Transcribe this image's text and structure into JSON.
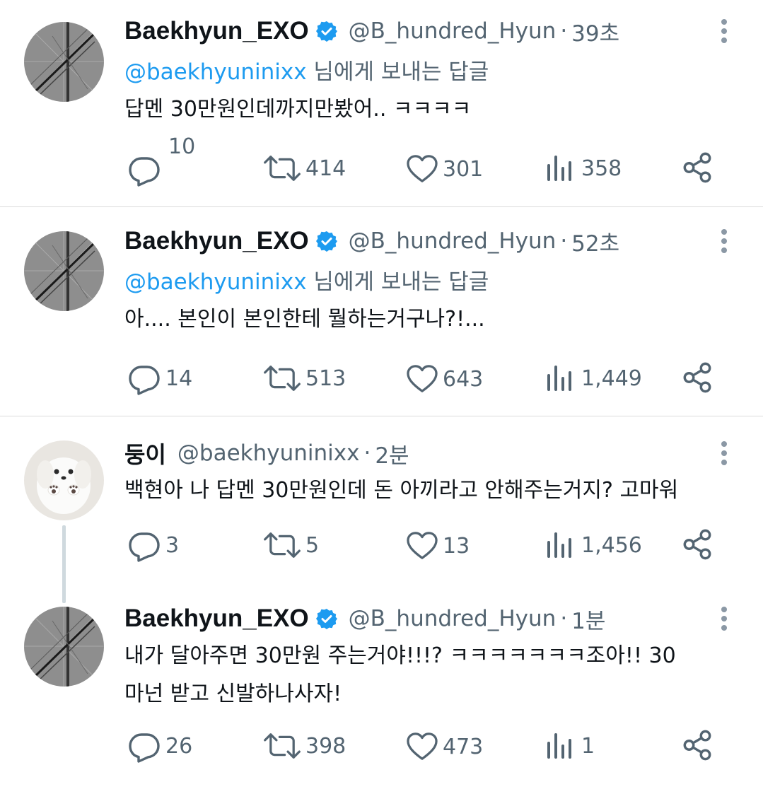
{
  "tweets": [
    {
      "name": "Baekhyun_EXO",
      "handle": "@B_hundred_Hyun",
      "dot": "·",
      "time": "39초",
      "reply_mention": "@baekhyuninixx",
      "reply_suffix": " 님에게 보내는 답글",
      "text": "답멘 30만원인데까지만봤어.. ㅋㅋㅋㅋ",
      "replies": "10",
      "retweets": "414",
      "likes": "301",
      "views": "358"
    },
    {
      "name": "Baekhyun_EXO",
      "handle": "@B_hundred_Hyun",
      "dot": "·",
      "time": "52초",
      "reply_mention": "@baekhyuninixx",
      "reply_suffix": " 님에게 보내는 답글",
      "text": "아.... 본인이 본인한테 뭘하는거구나?!...",
      "replies": "14",
      "retweets": "513",
      "likes": "643",
      "views": "1,449"
    },
    {
      "name": "둥이",
      "handle": "@baekhyuninixx",
      "dot": "·",
      "time": "2분",
      "text": "백현아 나 답멘 30만원인데 돈 아끼라고 안해주는거지? 고마워",
      "replies": "3",
      "retweets": "5",
      "likes": "13",
      "views": "1,456"
    },
    {
      "name": "Baekhyun_EXO",
      "handle": "@B_hundred_Hyun",
      "dot": "·",
      "time": "1분",
      "text": "내가 달아주면 30만원 주는거야!!!? ㅋㅋㅋㅋㅋㅋㅋ조아!! 30\n마넌 받고 신발하나사자!",
      "replies": "26",
      "retweets": "398",
      "likes": "473",
      "views": "1"
    }
  ],
  "colors": {
    "accent": "#1d9bf0",
    "secondary_text": "#536471",
    "divider": "#dcdcdc"
  },
  "icons": [
    "reply-icon",
    "retweet-icon",
    "like-icon",
    "views-icon",
    "share-icon",
    "more-icon",
    "verified-badge-icon"
  ]
}
